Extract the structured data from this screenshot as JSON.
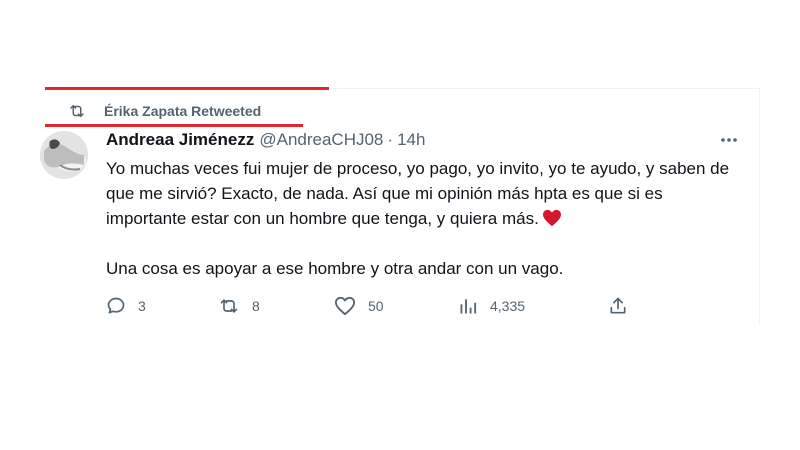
{
  "retweet_banner": {
    "text": "Érika Zapata Retweeted",
    "icon": "retweet-icon"
  },
  "tweet": {
    "display_name": "Andreaa Jiménezz",
    "handle": "@AndreaCHJ08",
    "separator": "·",
    "time": "14h",
    "body_paragraph_1": "Yo muchas veces fui mujer de proceso, yo pago, yo invito, yo te ayudo, y saben de que me sirvió? Exacto, de nada. Así que mi opinión más hpta es que si es importante estar con un hombre que tenga, y quiera más.",
    "body_emoji": "red-heart-icon",
    "body_paragraph_2": "Una cosa es apoyar a ese hombre y otra andar con un vago."
  },
  "actions": {
    "replies": "3",
    "retweets": "8",
    "likes": "50",
    "views": "4,335"
  },
  "colors": {
    "annotation_red": "#e0282e",
    "muted_text": "#536471",
    "primary_text": "#0f1419",
    "heart": "#d3172e"
  }
}
